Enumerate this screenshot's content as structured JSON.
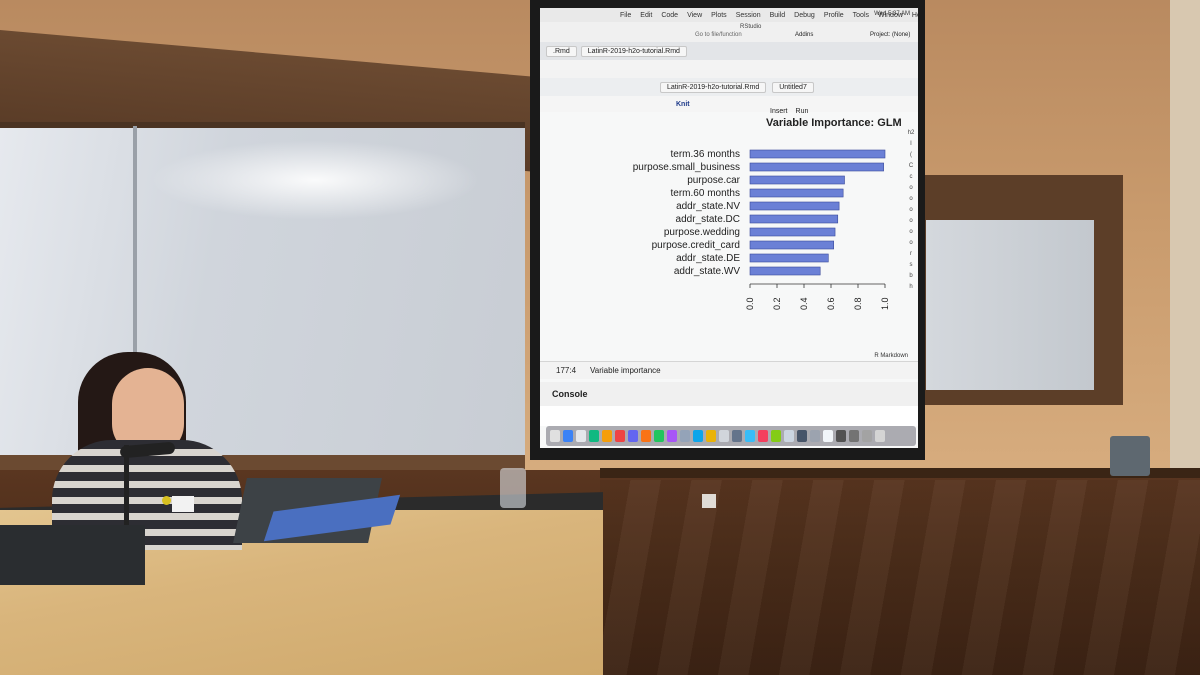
{
  "scene": {
    "description_tags": [
      "classroom",
      "projector-screen",
      "presenter",
      "podium"
    ]
  },
  "rstudio": {
    "menu": [
      "File",
      "Edit",
      "Code",
      "View",
      "Plots",
      "Session",
      "Build",
      "Debug",
      "Profile",
      "Tools",
      "Window",
      "Help"
    ],
    "clock": "Wed 5:37 AM",
    "window_title": "RStudio",
    "goto_placeholder": "Go to file/function",
    "addins": "Addins",
    "project": "Project: (None)",
    "tabs_row1": [
      ".Rmd",
      "LatinR-2019-h2o-tutorial.Rmd"
    ],
    "tabs_row2": [
      "LatinR-2019-h2o-tutorial.Rmd",
      "Untitled7"
    ],
    "knit_label": "Knit",
    "insert_label": "Insert",
    "run_label": "Run",
    "cursor_position": "177:4",
    "chunk_label": "Variable importance",
    "doc_type": "R Markdown",
    "console_label": "Console",
    "side_letters": [
      "h2",
      "I",
      "(",
      "C",
      "c",
      "o",
      "o",
      "o",
      "o",
      "o",
      "o",
      "r",
      "s",
      "b",
      "h"
    ]
  },
  "chart_data": {
    "type": "bar",
    "orientation": "horizontal",
    "title": "Variable Importance: GLM",
    "categories": [
      "term.36 months",
      "purpose.small_business",
      "purpose.car",
      "term.60 months",
      "addr_state.NV",
      "addr_state.DC",
      "purpose.wedding",
      "purpose.credit_card",
      "addr_state.DE",
      "addr_state.WV"
    ],
    "values": [
      1.0,
      0.99,
      0.7,
      0.69,
      0.66,
      0.65,
      0.63,
      0.62,
      0.58,
      0.52
    ],
    "xlim": [
      0,
      1.0
    ],
    "xticks": [
      "0.0",
      "0.2",
      "0.4",
      "0.6",
      "0.8",
      "1.0"
    ],
    "bar_color": "#6b80d6",
    "grid": false
  }
}
